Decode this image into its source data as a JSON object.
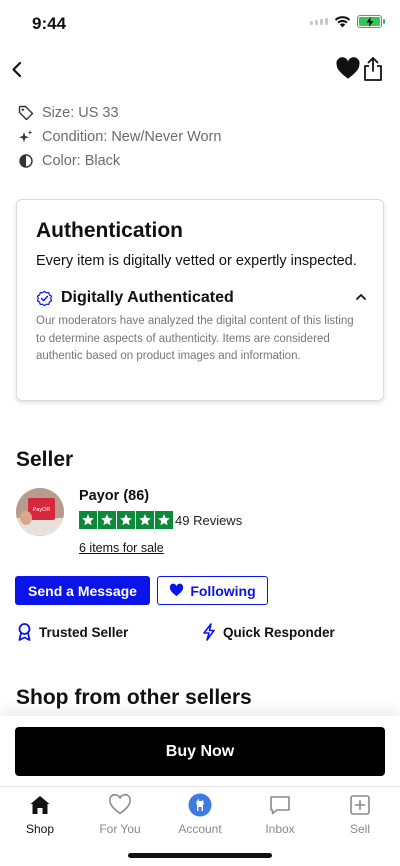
{
  "status": {
    "time": "9:44"
  },
  "details": {
    "size": "Size: US 33",
    "condition": "Condition: New/Never Worn",
    "color": "Color: Black"
  },
  "authentication": {
    "title": "Authentication",
    "subtitle": "Every item is digitally vetted or expertly inspected.",
    "method_label": "Digitally Authenticated",
    "description": "Our moderators have analyzed the digital content of this listing to determine aspects of authenticity. Items are considered authentic based on product images and information."
  },
  "seller": {
    "section_title": "Seller",
    "name": "Payor (86)",
    "avatar_text": "PayOR",
    "rating_stars": 5,
    "reviews": "49 Reviews",
    "items_link": "6 items for sale",
    "message_button": "Send a Message",
    "follow_button": "Following",
    "traits": [
      "Trusted Seller",
      "Quick Responder"
    ]
  },
  "shop_other_title": "Shop from other sellers",
  "buy_button": "Buy Now",
  "tabs": [
    {
      "label": "Shop",
      "icon": "home-icon"
    },
    {
      "label": "For You",
      "icon": "heart-outline-icon"
    },
    {
      "label": "Account",
      "icon": "account-icon"
    },
    {
      "label": "Inbox",
      "icon": "chat-bubble-icon"
    },
    {
      "label": "Sell",
      "icon": "plus-square-icon"
    }
  ],
  "colors": {
    "primary_blue": "#0a14e8",
    "star_green": "#0b8a3a",
    "battery_green": "#35c759",
    "account_blue": "#3d7be0"
  }
}
